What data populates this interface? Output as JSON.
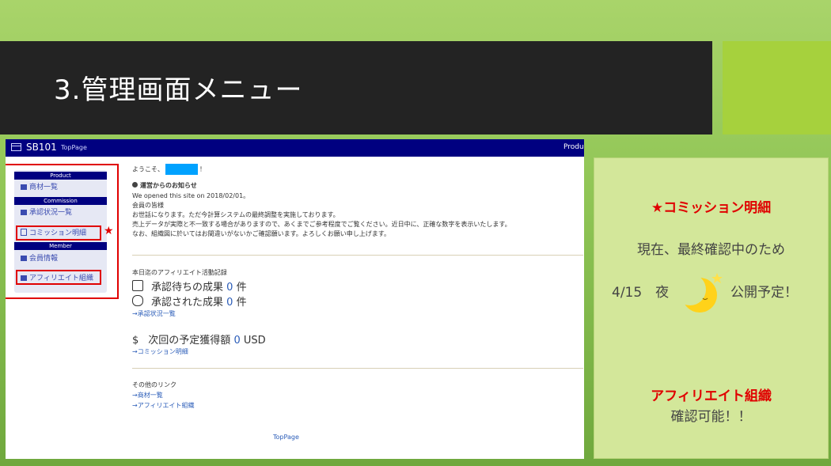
{
  "slide": {
    "title": "3.管理画面メニュー"
  },
  "app": {
    "brand": "SB101",
    "top_link": "TopPage",
    "product_nav": "Produ"
  },
  "sidebar": {
    "sections": [
      {
        "header": "Product",
        "items": [
          {
            "label": "商材一覧",
            "icon": "cart-icon"
          }
        ]
      },
      {
        "header": "Commission",
        "items": [
          {
            "label": "承認状況一覧",
            "icon": "list-icon"
          },
          {
            "label": "コミッション明細",
            "icon": "document-icon"
          }
        ]
      },
      {
        "header": "Member",
        "items": [
          {
            "label": "会員情報",
            "icon": "id-card-icon"
          },
          {
            "label": "アフィリエイト組織",
            "icon": "org-chart-icon"
          }
        ]
      }
    ],
    "marker": "★"
  },
  "main": {
    "welcome_prefix": "ようこそ、",
    "welcome_suffix": "！",
    "notice_title": "運営からのお知らせ",
    "notice_lines": [
      "We opened this site on 2018/02/01。",
      "会員の皆様",
      "お世話になります。ただ今計算システムの最終調整を実施しております。",
      "売上データが実際と不一致する場合がありますので、あくまでご参考程度でご覧ください。近日中に、正確な数字を表示いたします。",
      "なお、組織図に於いてはお間違いがないかご確認願います。よろしくお願い申し上げます。"
    ],
    "activity_title": "本日迄のアフィリエイト活動記録",
    "pending_label": "承認待ちの成果",
    "pending_count": "0",
    "pending_unit": "件",
    "approved_label": "承認された成果",
    "approved_count": "0",
    "approved_unit": "件",
    "status_link": "→承認状況一覧",
    "payout_symbol": "$",
    "payout_label": "次回の予定獲得額",
    "payout_amount": "0",
    "payout_currency": "USD",
    "commission_link": "→コミッション明細",
    "other_links_title": "その他のリンク",
    "other_links": [
      "→商材一覧",
      "→アフィリエイト組織"
    ],
    "footer_link": "TopPage"
  },
  "notice_panel": {
    "line1": "★コミッション明細",
    "line2": "現在、最終確認中のため",
    "line3_left": "4/15　夜",
    "line3_right": "公開予定！",
    "line4": "アフィリエイト組織",
    "line5": "確認可能！！",
    "colors": {
      "red": "#e00000",
      "panel": "#d3e79a"
    }
  }
}
